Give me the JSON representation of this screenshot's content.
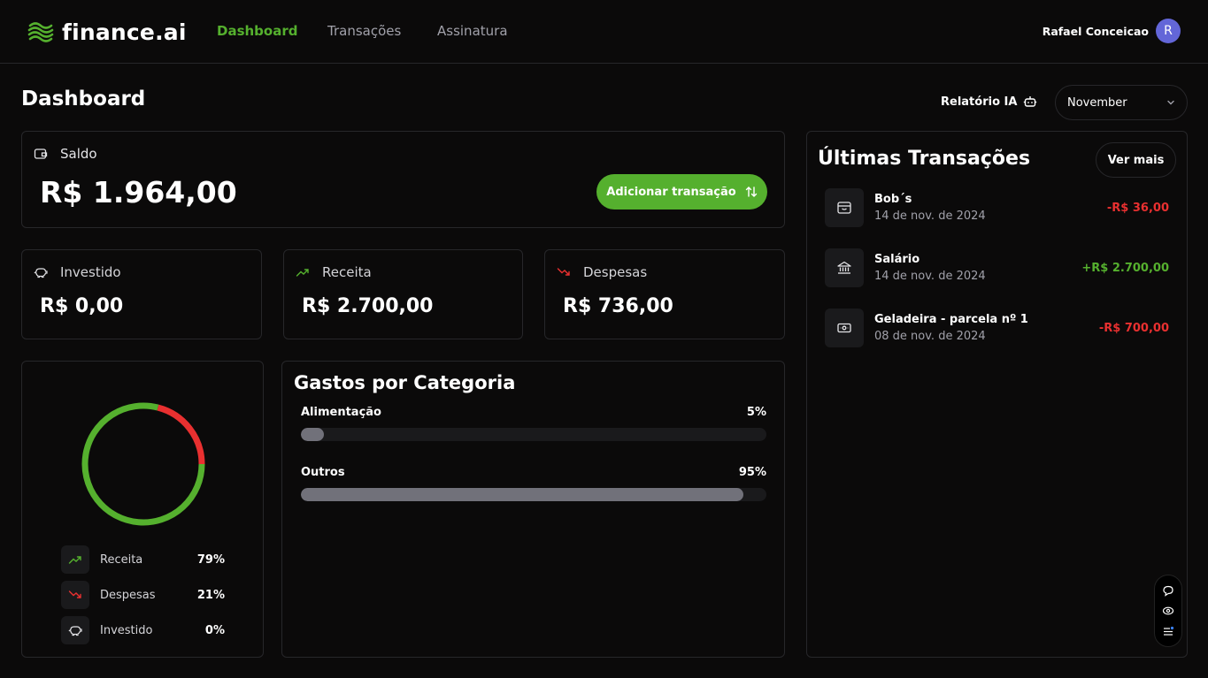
{
  "nav": {
    "logo": "finance.ai",
    "links": [
      "Dashboard",
      "Transações",
      "Assinatura"
    ],
    "user_name": "Rafael Conceicao",
    "avatar_initial": "R"
  },
  "header": {
    "title": "Dashboard",
    "report_label": "Relatório IA",
    "month": "November"
  },
  "balance": {
    "label": "Saldo",
    "value": "R$ 1.964,00",
    "add_button": "Adicionar transação"
  },
  "summary": [
    {
      "label": "Investido",
      "value": "R$ 0,00",
      "icon": "piggy-bank-icon"
    },
    {
      "label": "Receita",
      "value": "R$ 2.700,00",
      "icon": "trending-up-icon"
    },
    {
      "label": "Despesas",
      "value": "R$ 736,00",
      "icon": "trending-down-icon"
    }
  ],
  "donut": {
    "items": [
      {
        "label": "Receita",
        "pct": "79%",
        "value": 79,
        "color": "#55b02e"
      },
      {
        "label": "Despesas",
        "pct": "21%",
        "value": 21,
        "color": "#e93030"
      },
      {
        "label": "Investido",
        "pct": "0%",
        "value": 0,
        "color": "#ffffff"
      }
    ]
  },
  "categories": {
    "title": "Gastos por Categoria",
    "items": [
      {
        "name": "Alimentação",
        "pct": "5%",
        "value": 5
      },
      {
        "name": "Outros",
        "pct": "95%",
        "value": 95
      }
    ]
  },
  "transactions": {
    "title": "Últimas Transações",
    "more_button": "Ver mais",
    "items": [
      {
        "name": "Bob´s",
        "date": "14 de nov. de 2024",
        "amount": "-R$ 36,00",
        "type": "expense",
        "icon": "card-icon"
      },
      {
        "name": "Salário",
        "date": "14 de nov. de 2024",
        "amount": "+R$ 2.700,00",
        "type": "income",
        "icon": "bank-icon"
      },
      {
        "name": "Geladeira - parcela nº 1",
        "date": "08 de nov. de 2024",
        "amount": "-R$ 700,00",
        "type": "expense",
        "icon": "cash-icon"
      }
    ]
  },
  "colors": {
    "accent": "#55b02e",
    "expense": "#e93030",
    "background": "#0b0a0a",
    "border": "#27272a",
    "avatar": "#6366d8"
  }
}
